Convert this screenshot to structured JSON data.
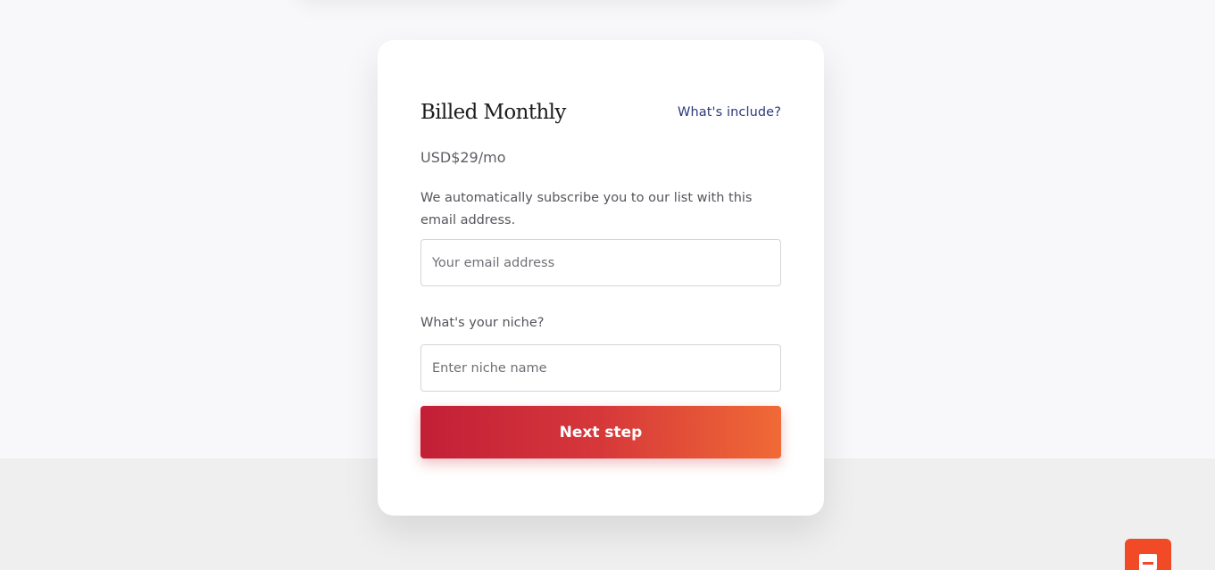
{
  "card": {
    "title": "Billed Monthly",
    "whats_include_link": "What's include?",
    "price": "USD$29/mo",
    "helper_text": "We automatically subscribe you to our list with this email address.",
    "email": {
      "placeholder": "Your email address",
      "value": ""
    },
    "niche": {
      "label": "What's your niche?",
      "placeholder": "Enter niche name",
      "value": ""
    },
    "next_button_label": "Next step"
  },
  "colors": {
    "page_background": "#f8f8fa",
    "bottom_band": "#efefef",
    "link": "#2c3a7a",
    "button_gradient_start": "#c21f37",
    "button_gradient_end": "#f06a36",
    "chat_button": "#f04a26"
  },
  "chat_widget": {
    "icon": "chat-bubble-icon"
  }
}
